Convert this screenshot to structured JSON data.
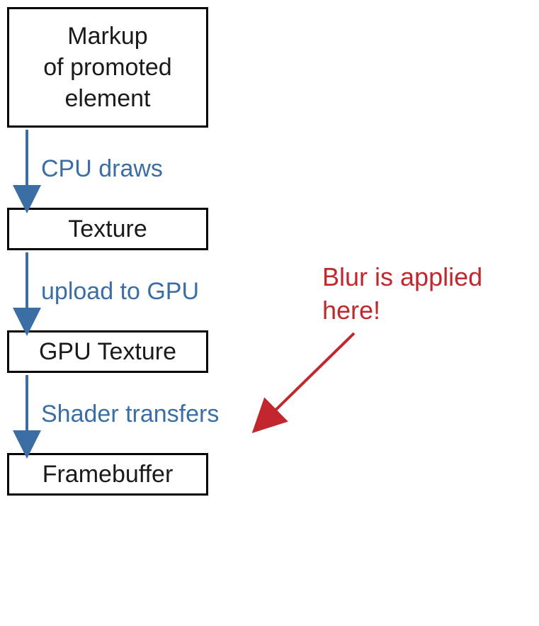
{
  "diagram": {
    "boxes": {
      "markup": "Markup\nof promoted\nelement",
      "texture": "Texture",
      "gpu_texture": "GPU Texture",
      "framebuffer": "Framebuffer"
    },
    "arrows": {
      "cpu_draws": "CPU draws",
      "upload_gpu": "upload to GPU",
      "shader_transfers": "Shader transfers"
    },
    "annotation": "Blur is applied\nhere!"
  },
  "colors": {
    "box_border": "#000000",
    "arrow": "#3b6ea5",
    "annotation": "#c1272d"
  }
}
